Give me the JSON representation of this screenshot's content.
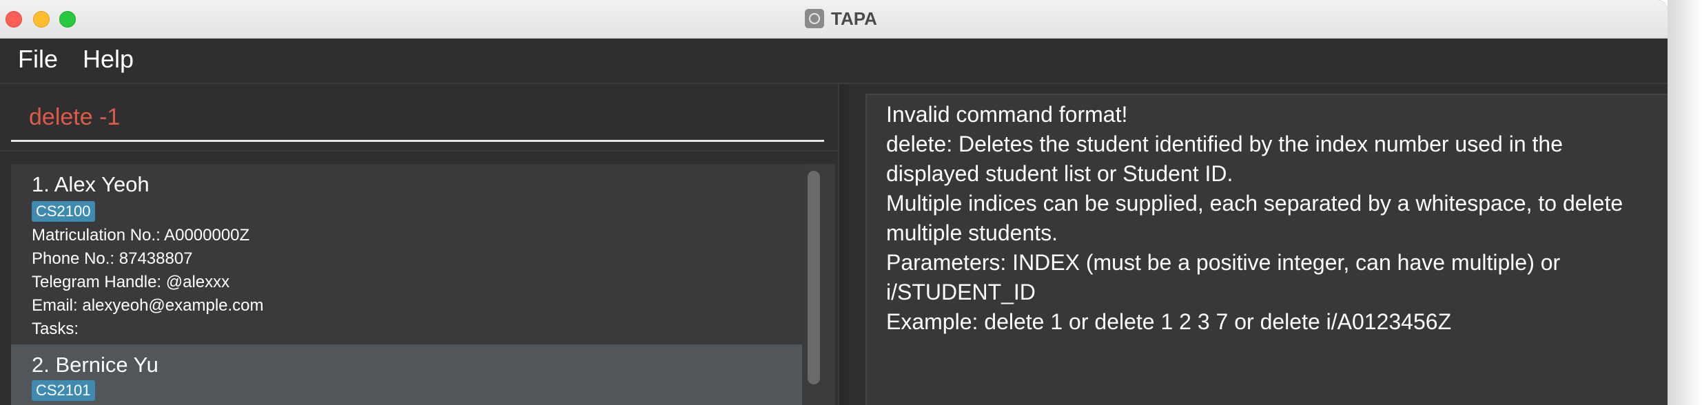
{
  "window": {
    "title": "TAPA"
  },
  "menu": {
    "file_label": "File",
    "help_label": "Help"
  },
  "command": {
    "value": "delete -1",
    "text_color": "#e05a4a"
  },
  "students": [
    {
      "name": "1.  Alex Yeoh",
      "tag": "CS2100",
      "matric": "Matriculation No.: A0000000Z",
      "phone": "Phone No.: 87438807",
      "telegram": "Telegram Handle: @alexxx",
      "email": "Email: alexyeoh@example.com",
      "tasks": "Tasks:"
    },
    {
      "name": "2.  Bernice Yu",
      "tag": "CS2101"
    }
  ],
  "result": {
    "lines": [
      "Invalid command format!",
      "delete: Deletes the student identified by the index number used in the",
      "displayed student list or Student ID.",
      "Multiple indices can be supplied, each separated by a whitespace, to delete",
      "multiple students.",
      "Parameters: INDEX (must be a positive integer, can have multiple) or",
      "i/STUDENT_ID",
      "Example: delete 1 or delete 1 2 3 7 or delete i/A0123456Z"
    ]
  },
  "colors": {
    "background": "#2f2f2f",
    "tag": "#3e8ab0",
    "selected_card": "#505659"
  }
}
